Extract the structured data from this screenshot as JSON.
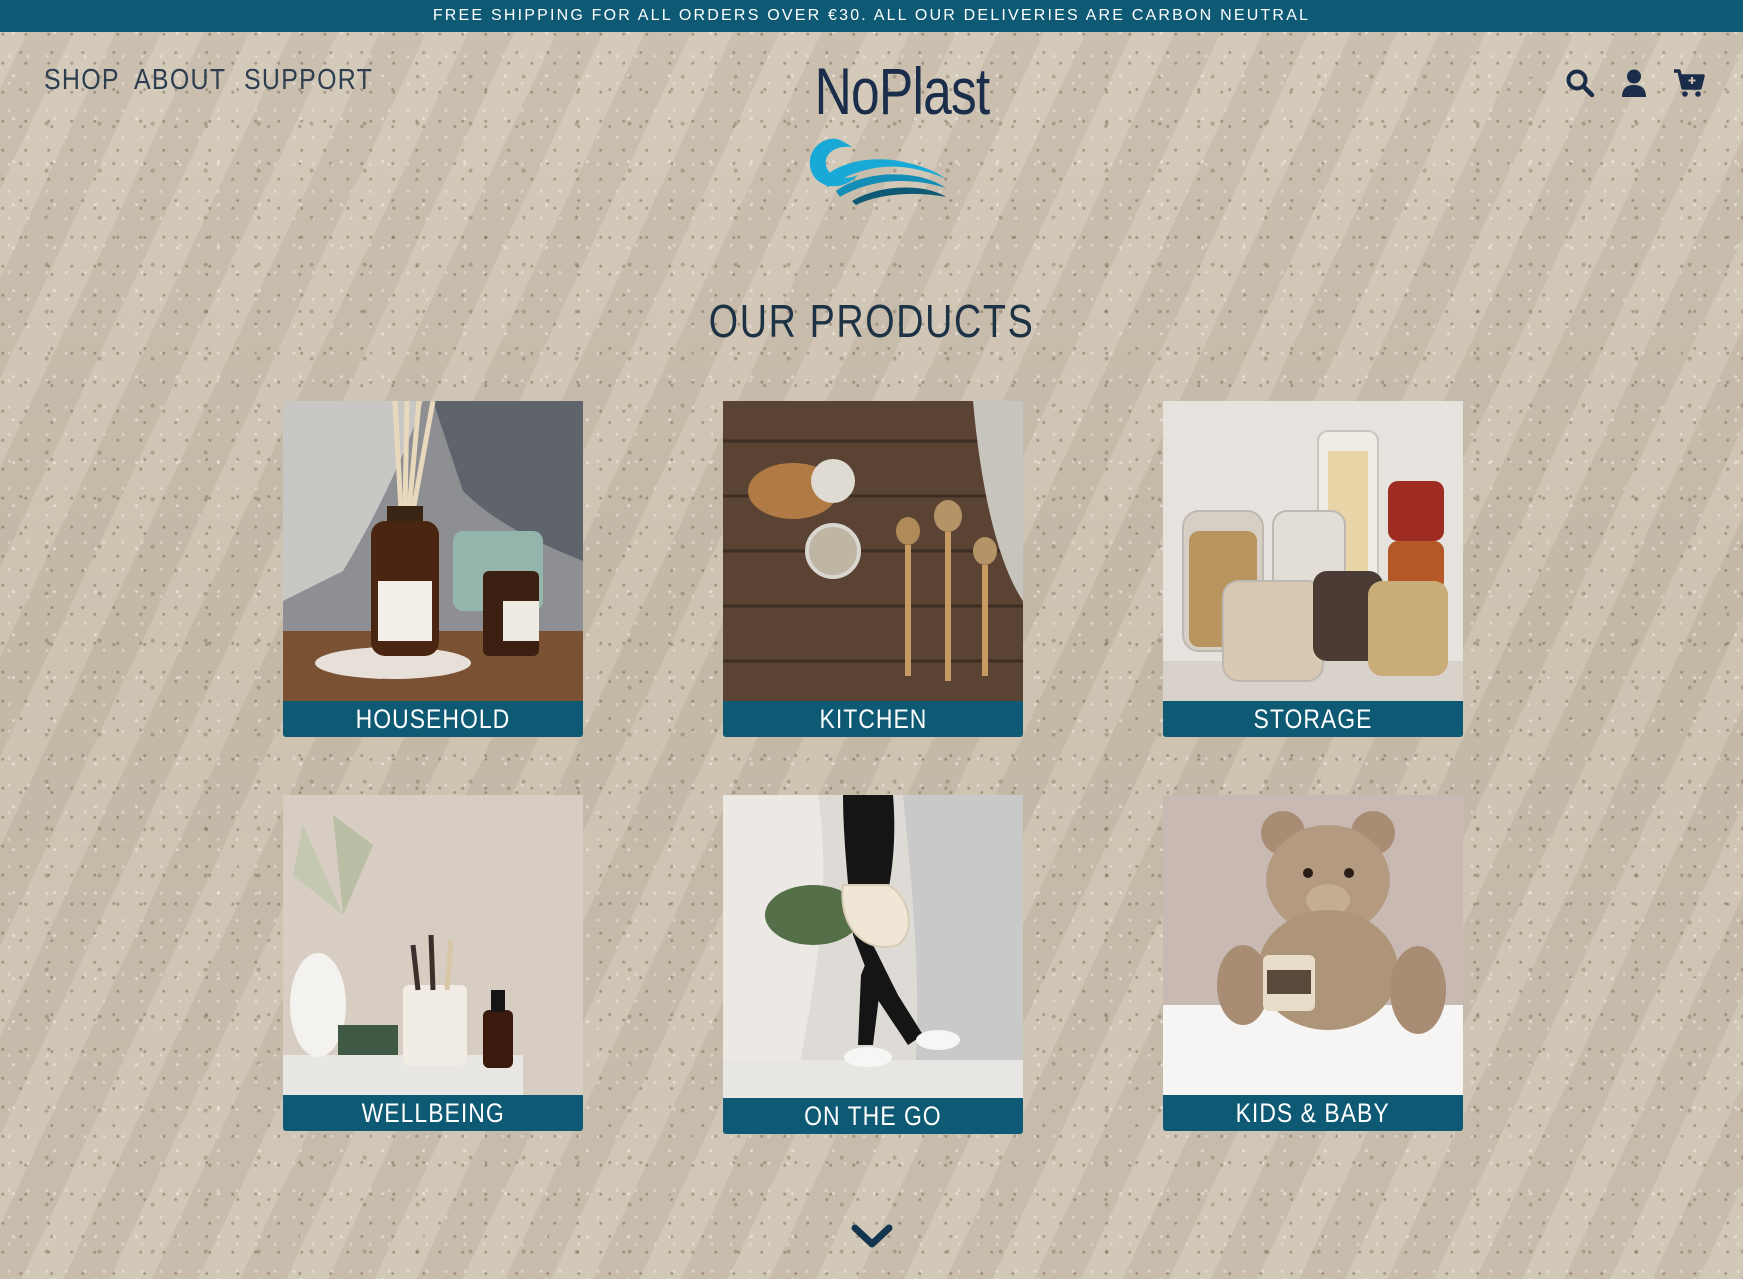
{
  "banner": {
    "text": "FREE SHIPPING FOR ALL ORDERS OVER €30. ALL OUR DELIVERIES ARE CARBON NEUTRAL"
  },
  "nav": {
    "items": [
      "SHOP",
      "ABOUT",
      "SUPPORT"
    ]
  },
  "logo": {
    "text": "NoPlast"
  },
  "header_icons": [
    "search-icon",
    "account-icon",
    "cart-icon"
  ],
  "section": {
    "title": "OUR PRODUCTS"
  },
  "categories": [
    {
      "label": "HOUSEHOLD"
    },
    {
      "label": "KITCHEN"
    },
    {
      "label": "STORAGE"
    },
    {
      "label": "WELLBEING"
    },
    {
      "label": "ON THE GO"
    },
    {
      "label": "KIDS & BABY"
    }
  ],
  "colors": {
    "brand": "#0e5a75",
    "text": "#1d3245",
    "sand": "#cfc4b3",
    "wave_light": "#19a9d6",
    "wave_dark": "#0e5a75"
  },
  "scroll_icon": "chevron-down-icon"
}
